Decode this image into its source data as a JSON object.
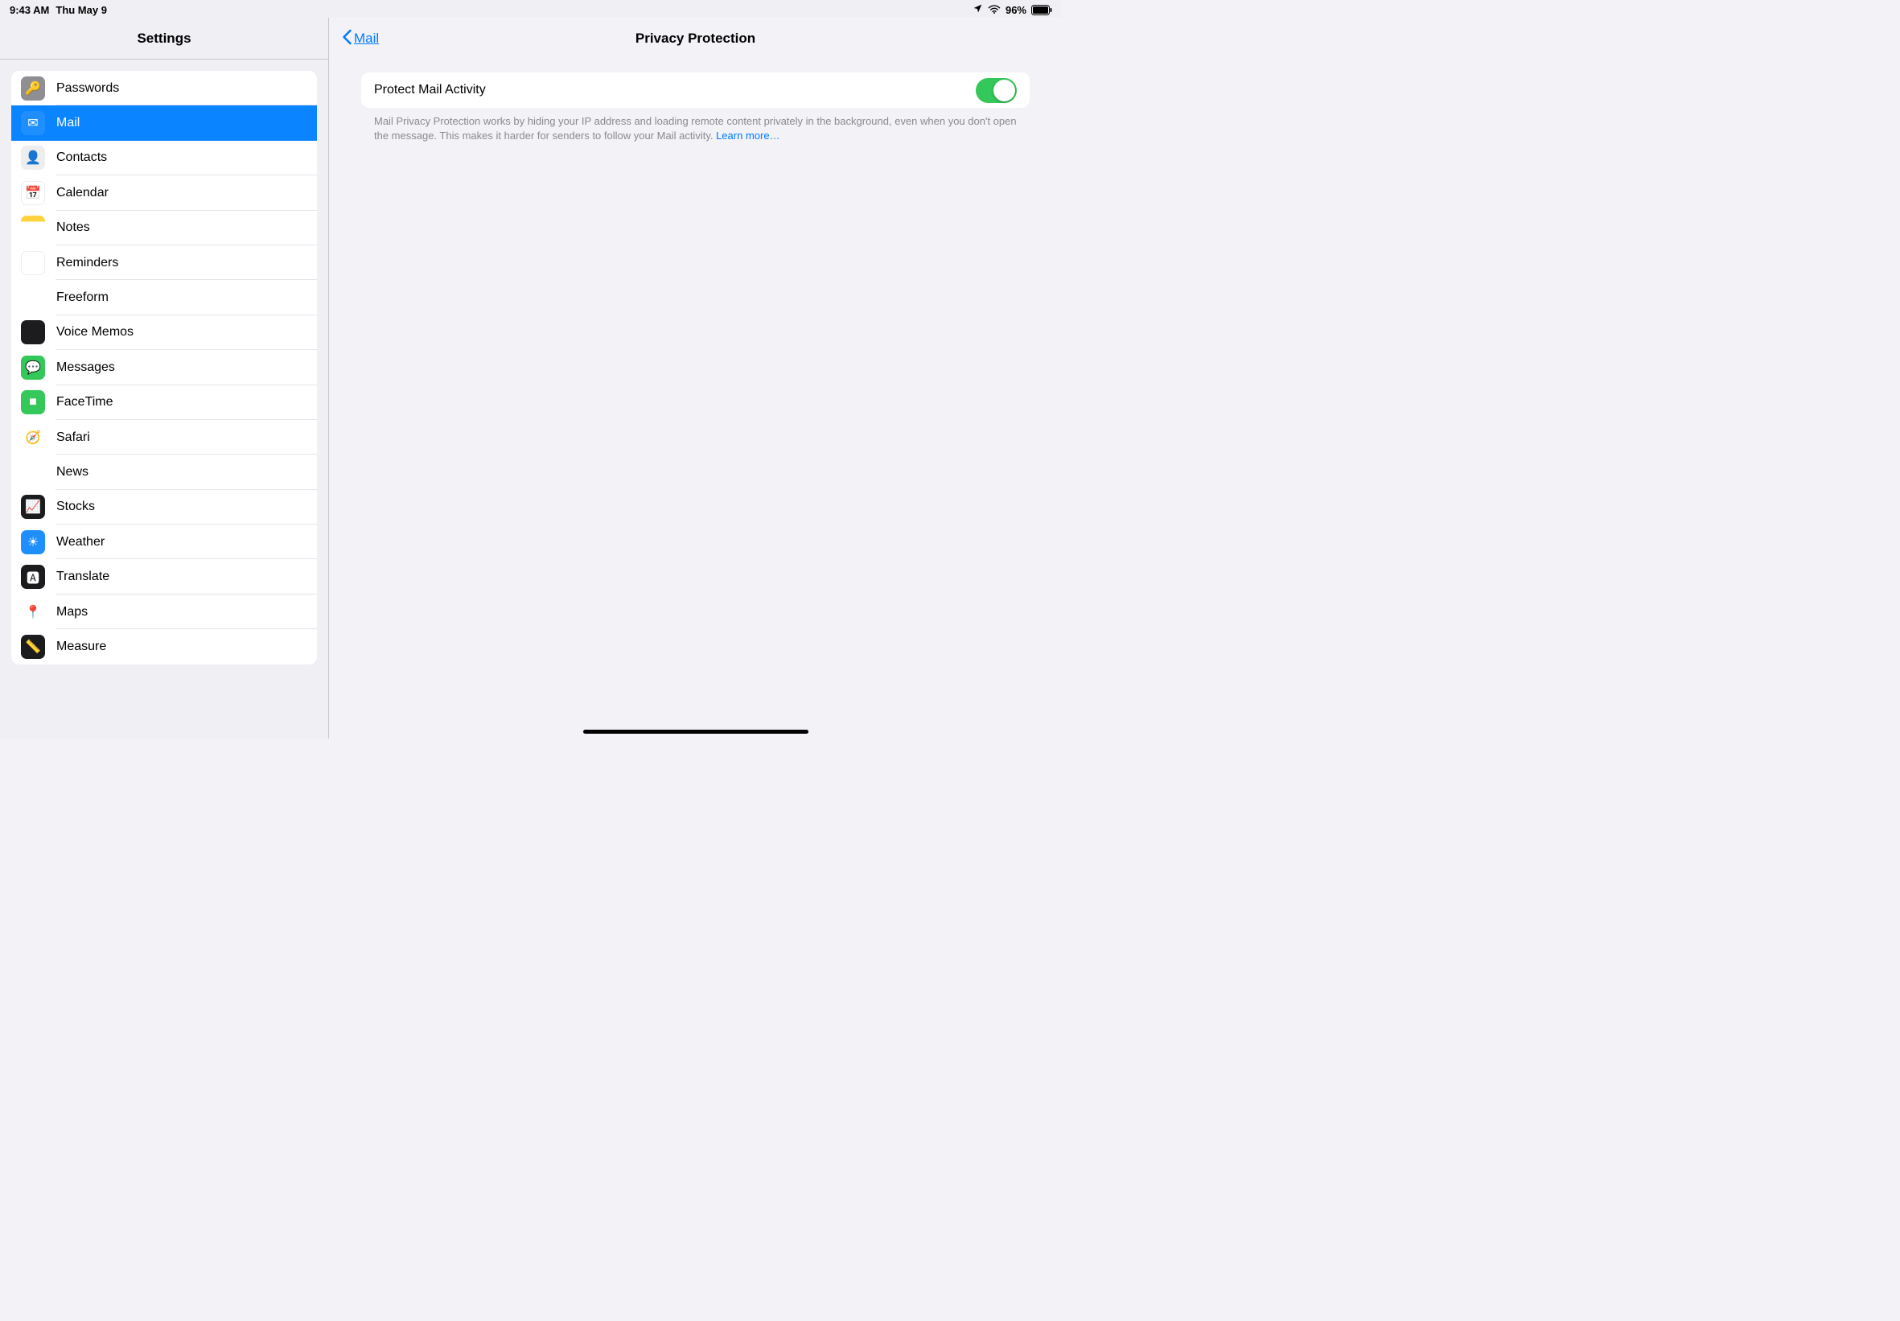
{
  "status": {
    "time": "9:43 AM",
    "date": "Thu May 9",
    "battery": "96%"
  },
  "sidebar": {
    "title": "Settings",
    "items": [
      {
        "label": "Passwords",
        "icon": "passwords-icon",
        "selected": false,
        "cls": "ic-passwords",
        "glyph": "🔑"
      },
      {
        "label": "Mail",
        "icon": "mail-icon",
        "selected": true,
        "cls": "ic-mail",
        "glyph": "✉︎"
      },
      {
        "label": "Contacts",
        "icon": "contacts-icon",
        "selected": false,
        "cls": "ic-contacts",
        "glyph": "👤"
      },
      {
        "label": "Calendar",
        "icon": "calendar-icon",
        "selected": false,
        "cls": "ic-calendar",
        "glyph": "📅"
      },
      {
        "label": "Notes",
        "icon": "notes-icon",
        "selected": false,
        "cls": "ic-notes",
        "glyph": ""
      },
      {
        "label": "Reminders",
        "icon": "reminders-icon",
        "selected": false,
        "cls": "ic-reminders",
        "glyph": ""
      },
      {
        "label": "Freeform",
        "icon": "freeform-icon",
        "selected": false,
        "cls": "ic-freeform",
        "glyph": "〰"
      },
      {
        "label": "Voice Memos",
        "icon": "voice-memos-icon",
        "selected": false,
        "cls": "ic-voicememos",
        "glyph": ""
      },
      {
        "label": "Messages",
        "icon": "messages-icon",
        "selected": false,
        "cls": "ic-messages",
        "glyph": "💬"
      },
      {
        "label": "FaceTime",
        "icon": "facetime-icon",
        "selected": false,
        "cls": "ic-facetime",
        "glyph": "■"
      },
      {
        "label": "Safari",
        "icon": "safari-icon",
        "selected": false,
        "cls": "ic-safari",
        "glyph": "🧭"
      },
      {
        "label": "News",
        "icon": "news-icon",
        "selected": false,
        "cls": "ic-news",
        "glyph": "N"
      },
      {
        "label": "Stocks",
        "icon": "stocks-icon",
        "selected": false,
        "cls": "ic-stocks",
        "glyph": "📈"
      },
      {
        "label": "Weather",
        "icon": "weather-icon",
        "selected": false,
        "cls": "ic-weather",
        "glyph": "☀"
      },
      {
        "label": "Translate",
        "icon": "translate-icon",
        "selected": false,
        "cls": "ic-translate",
        "glyph": "🅰"
      },
      {
        "label": "Maps",
        "icon": "maps-icon",
        "selected": false,
        "cls": "ic-maps",
        "glyph": "📍"
      },
      {
        "label": "Measure",
        "icon": "measure-icon",
        "selected": false,
        "cls": "ic-measure",
        "glyph": "📏"
      }
    ]
  },
  "detail": {
    "back_label": "Mail",
    "title": "Privacy Protection",
    "setting": {
      "label": "Protect Mail Activity",
      "on": true
    },
    "footer": "Mail Privacy Protection works by hiding your IP address and loading remote content privately in the background, even when you don't open the message. This makes it harder for senders to follow your Mail activity. ",
    "learn_more": "Learn more…"
  }
}
